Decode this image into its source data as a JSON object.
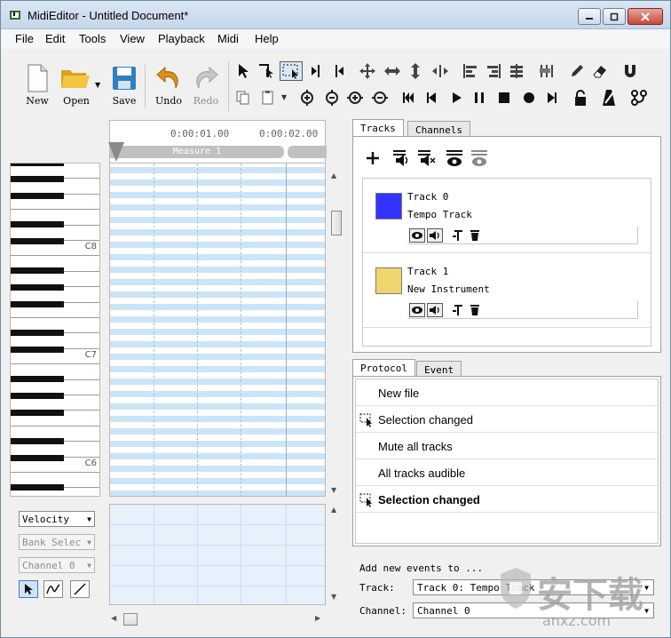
{
  "window": {
    "title": "MidiEditor - Untitled Document*"
  },
  "menu": [
    "File",
    "Edit",
    "Tools",
    "View",
    "Playback",
    "Midi",
    "Help"
  ],
  "toolbar": {
    "new_label": "New",
    "open_label": "Open",
    "save_label": "Save",
    "undo_label": "Undo",
    "redo_label": "Redo"
  },
  "ruler": {
    "time1": "0:00:01.00",
    "time2": "0:00:02.00",
    "measure": "Measure 1"
  },
  "piano": {
    "octaves": [
      "C8",
      "C7",
      "C6"
    ]
  },
  "left_controls": {
    "velocity": "Velocity",
    "bank": "Bank Selec",
    "channel": "Channel 0"
  },
  "tabs": {
    "tracks": "Tracks",
    "channels": "Channels",
    "protocol": "Protocol",
    "event": "Event"
  },
  "tracks": [
    {
      "name": "Track 0",
      "instrument": "Tempo Track",
      "color": "#3333ff"
    },
    {
      "name": "Track 1",
      "instrument": "New Instrument",
      "color": "#f0d56e"
    }
  ],
  "protocol": [
    {
      "text": "New file",
      "icon": "",
      "bold": false
    },
    {
      "text": "Selection changed",
      "icon": "selection-icon",
      "bold": false
    },
    {
      "text": "Mute all tracks",
      "icon": "",
      "bold": false
    },
    {
      "text": "All tracks audible",
      "icon": "",
      "bold": false
    },
    {
      "text": "Selection changed",
      "icon": "selection-icon",
      "bold": true
    }
  ],
  "add_events": {
    "heading": "Add new events to ...",
    "track_label": "Track:",
    "track_value": "Track 0: Tempo Track",
    "channel_label": "Channel:",
    "channel_value": "Channel 0"
  },
  "watermark": {
    "text": "安下载",
    "sub": "anxz.com"
  }
}
